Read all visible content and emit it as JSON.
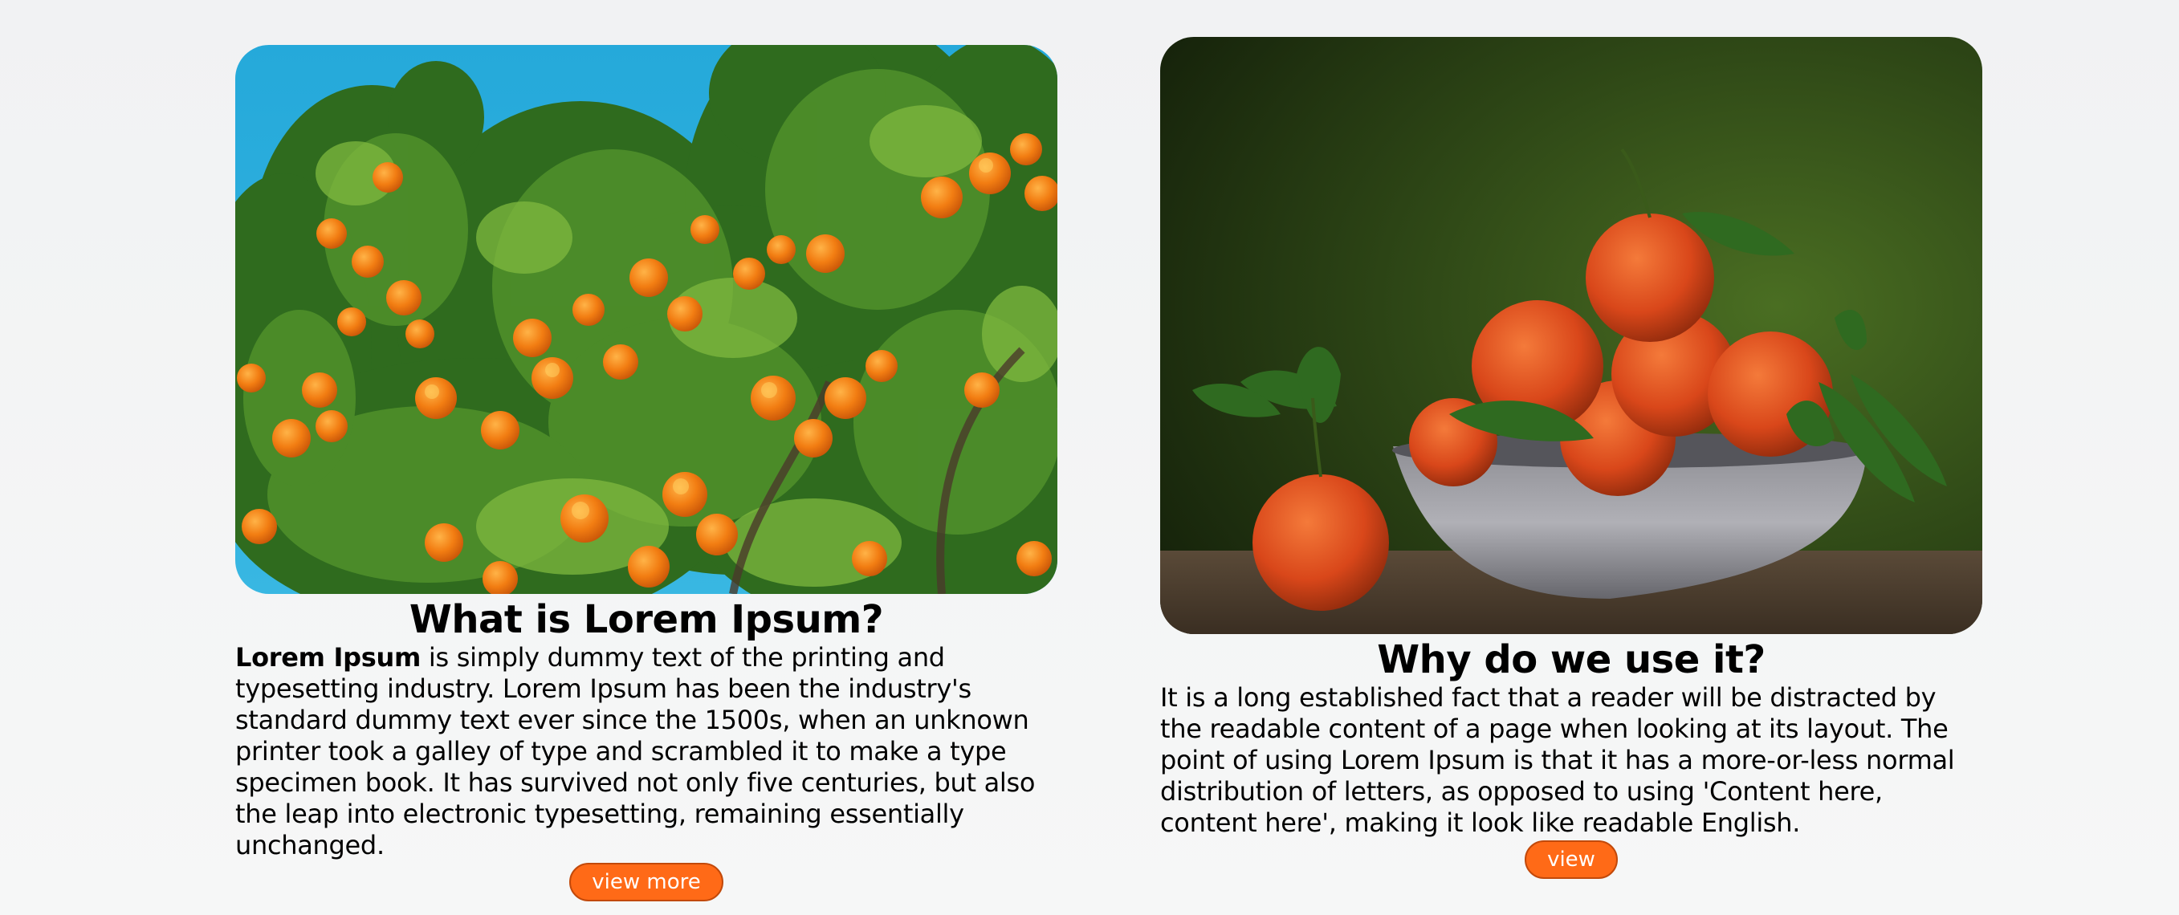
{
  "cards": [
    {
      "image_subject": "orange tree with ripe oranges against a blue sky",
      "title": "What is Lorem Ipsum?",
      "text_bold": "Lorem Ipsum",
      "text": " is simply dummy text of the printing and typesetting industry. Lorem Ipsum has been the industry's standard dummy text ever since the 1500s, when an unknown printer took a galley of type and scrambled it to make a type specimen book. It has survived not only five centuries, but also the leap into electronic typesetting, remaining essentially unchanged.",
      "button_label": "view more"
    },
    {
      "image_subject": "still life of tangerines in a grey bowl on a wooden table",
      "title": "Why do we use it?",
      "text": "It is a long established fact that a reader will be distracted by the readable content of a page when looking at its layout. The point of using Lorem Ipsum is that it has a more-or-less normal distribution of letters, as opposed to using 'Content here, content here', making it look like readable English.",
      "button_label": "view"
    }
  ],
  "colors": {
    "button": "#ff6a17",
    "button_border": "#c2490a",
    "sky": "#2aaedb",
    "orange": "#f07a1a",
    "wall": "#2f4a18"
  }
}
